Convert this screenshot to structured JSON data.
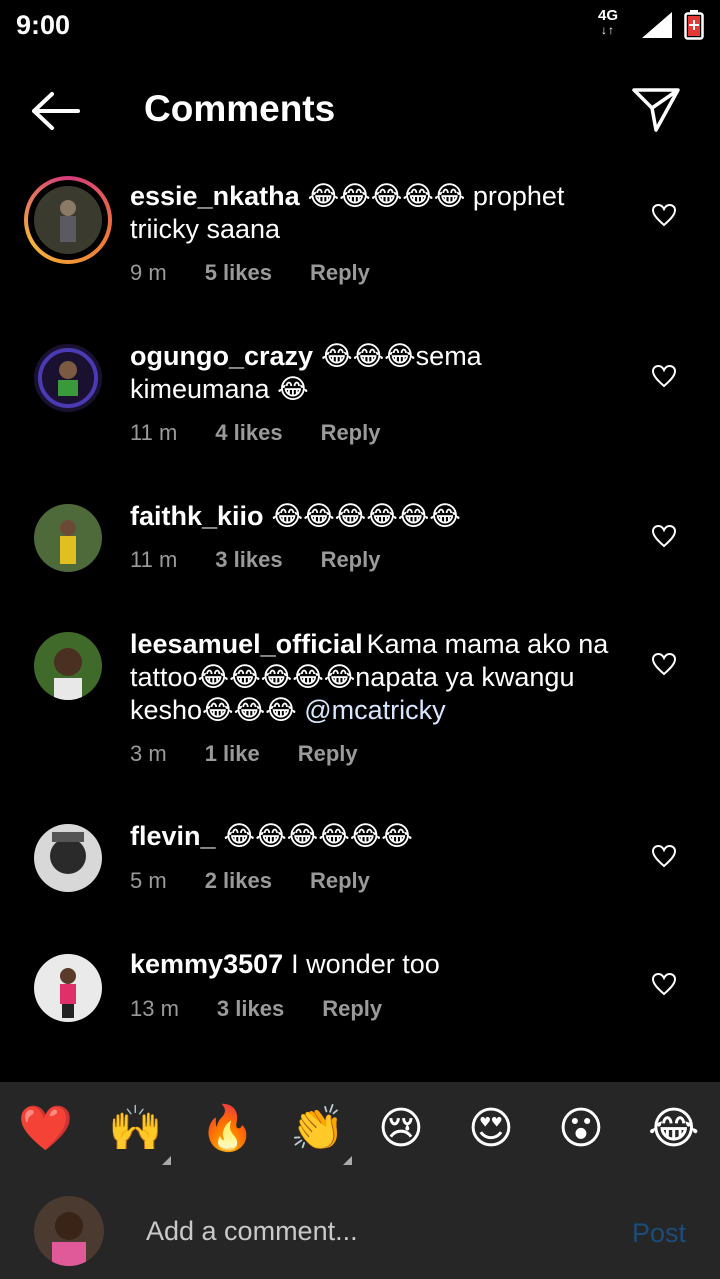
{
  "status": {
    "time": "9:00",
    "network": "4G",
    "network_arrows": "↓↑"
  },
  "header": {
    "title": "Comments"
  },
  "comments": [
    {
      "user": "essie_nkatha",
      "text": "😂😂😂😂😂 prophet triicky saana",
      "mention": "",
      "time": "9 m",
      "likes": "5 likes",
      "reply": "Reply"
    },
    {
      "user": "ogungo_crazy",
      "text": "😂😂😂sema kimeumana 😂",
      "mention": "",
      "time": "11 m",
      "likes": "4 likes",
      "reply": "Reply"
    },
    {
      "user": "faithk_kiio",
      "text": "😂😂😂😂😂😂",
      "mention": "",
      "time": "11 m",
      "likes": "3 likes",
      "reply": "Reply"
    },
    {
      "user": "leesamuel_official",
      "text": "Kama mama ako na tattoo😂😂😂😂😂napata ya kwangu kesho😂😂😂 ",
      "mention": "@mcatricky",
      "time": "3 m",
      "likes": "1 like",
      "reply": "Reply"
    },
    {
      "user": "flevin_",
      "text": "😂😂😂😂😂😂",
      "mention": "",
      "time": "5 m",
      "likes": "2 likes",
      "reply": "Reply"
    },
    {
      "user": "kemmy3507",
      "text": "I wonder too",
      "mention": "",
      "time": "13 m",
      "likes": "3 likes",
      "reply": "Reply"
    }
  ],
  "emoji_bar": [
    "❤️",
    "🙌",
    "🔥",
    "👏",
    "😢",
    "😍",
    "😮",
    "😂"
  ],
  "compose": {
    "placeholder": "Add a comment...",
    "post_label": "Post"
  },
  "colors": {
    "background": "#000000",
    "panel": "#262626",
    "muted": "#9a9a9a",
    "post_disabled": "#1b4d7a"
  }
}
